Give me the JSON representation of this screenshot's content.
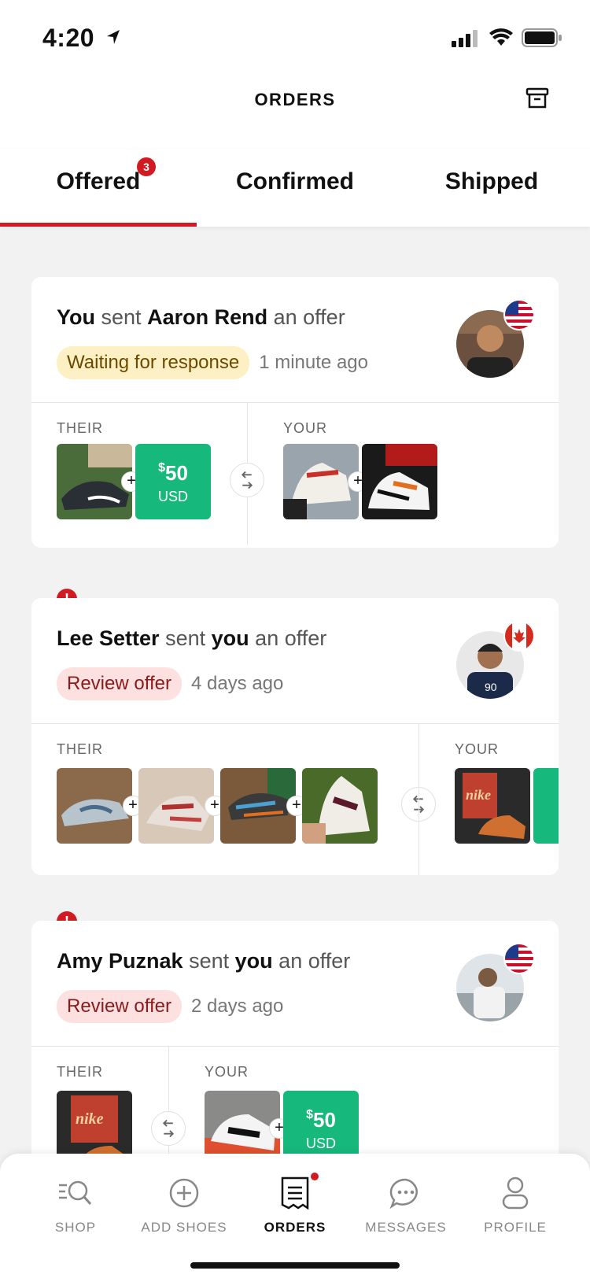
{
  "status_bar": {
    "time": "4:20"
  },
  "header": {
    "title": "ORDERS"
  },
  "tabs": [
    {
      "label": "Offered",
      "badge": "3"
    },
    {
      "label": "Confirmed"
    },
    {
      "label": "Shipped"
    }
  ],
  "cards": [
    {
      "head": {
        "sender": "You",
        "verb": "sent",
        "recipient": "Aaron Rend",
        "suffix": "an offer"
      },
      "status": "Waiting for response",
      "time_ago": "1 minute ago",
      "flag": "us-flag",
      "their_label": "THEIR",
      "your_label": "YOUR",
      "their_cash": {
        "amount": "50",
        "currency_symbol": "$",
        "currency": "USD"
      }
    },
    {
      "head": {
        "sender": "Lee Setter",
        "verb": "sent",
        "recipient": "you",
        "suffix": "an offer"
      },
      "status": "Review offer",
      "time_ago": "4 days ago",
      "flag": "canada-flag",
      "their_label": "THEIR",
      "your_label": "YOUR",
      "alert": "!"
    },
    {
      "head": {
        "sender": "Amy Puznak",
        "verb": "sent",
        "recipient": "you",
        "suffix": "an offer"
      },
      "status": "Review offer",
      "time_ago": "2 days ago",
      "flag": "us-flag",
      "their_label": "THEIR",
      "your_label": "YOUR",
      "alert": "!",
      "your_cash": {
        "amount": "50",
        "currency_symbol": "$",
        "currency": "USD"
      }
    }
  ],
  "nav": [
    {
      "label": "SHOP",
      "icon": "shop-search-icon"
    },
    {
      "label": "ADD SHOES",
      "icon": "plus-circle-icon"
    },
    {
      "label": "ORDERS",
      "icon": "receipt-icon",
      "active": true
    },
    {
      "label": "MESSAGES",
      "icon": "chat-bubble-icon"
    },
    {
      "label": "PROFILE",
      "icon": "person-icon"
    }
  ],
  "colors": {
    "accent": "#d11b22",
    "cash": "#17b87b",
    "wait_pill": "#fdf0c5",
    "review_pill": "#fde0e0"
  }
}
